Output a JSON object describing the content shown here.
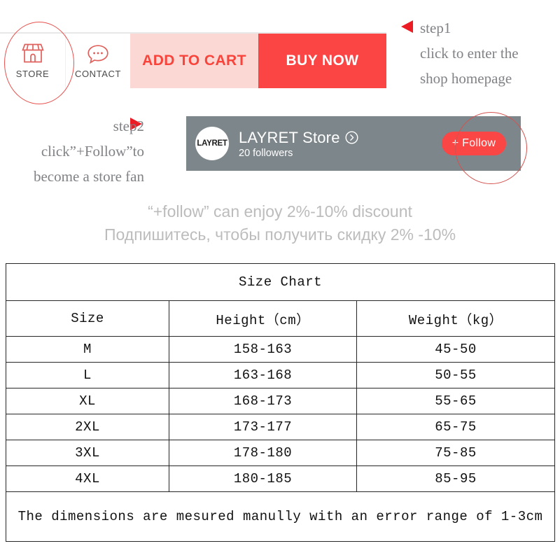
{
  "action_bar": {
    "store": {
      "label": "STORE",
      "icon": "store-icon"
    },
    "contact": {
      "label": "CONTACT",
      "icon": "chat-bubble-icon"
    },
    "add_to_cart": "ADD TO CART",
    "buy_now": "BUY NOW",
    "colors": {
      "cart_bg": "#fcd8d4",
      "cart_text": "#f9443c",
      "buy_bg": "#fb4545",
      "buy_text": "#ffffff",
      "highlight_circle": "#e8514e"
    }
  },
  "annotations": {
    "step1": {
      "arrow": "left-arrow-icon",
      "line1": "step1",
      "line2": "click to enter the",
      "line3": "shop homepage"
    },
    "step2": {
      "arrow": "right-arrow-icon",
      "line1": "step2",
      "line2": "click”+Follow”to",
      "line3": "become a store fan"
    },
    "arrow_color": "#ec1c24",
    "text_color": "#808286"
  },
  "store_banner": {
    "avatar_text": "LAYRET",
    "store_name": "LAYRET  Store",
    "store_link_icon": "circle-chevron-right-icon",
    "followers": "20 followers",
    "follow_button": "+ Follow",
    "bg_color": "#7d868b",
    "follow_color": "#fb4646"
  },
  "discount": {
    "english": "“+follow”  can enjoy 2%-10% discount",
    "russian": "Подпишитесь, чтобы получить скидку 2% -10%",
    "color": "#bcbcbc"
  },
  "size_chart": {
    "title": "Size Chart",
    "columns": [
      "Size",
      "Height（cm）",
      "Weight（kg）"
    ],
    "rows": [
      {
        "size": "M",
        "height": "158-163",
        "weight": "45-50"
      },
      {
        "size": "L",
        "height": "163-168",
        "weight": "50-55"
      },
      {
        "size": "XL",
        "height": "168-173",
        "weight": "55-65"
      },
      {
        "size": "2XL",
        "height": "173-177",
        "weight": "65-75"
      },
      {
        "size": "3XL",
        "height": "178-180",
        "weight": "75-85"
      },
      {
        "size": "4XL",
        "height": "180-185",
        "weight": "85-95"
      }
    ],
    "footnote": "The dimensions are mesured manully with an error range of 1-3cm"
  }
}
